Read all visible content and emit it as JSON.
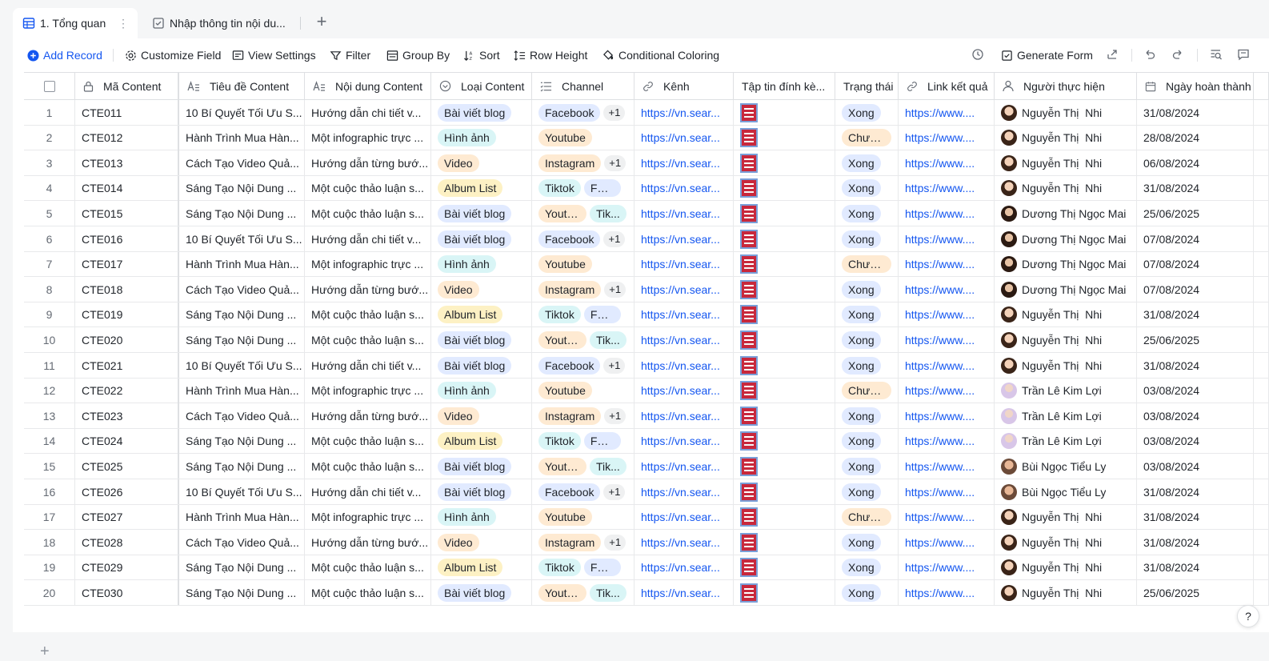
{
  "tabs": [
    {
      "label": "1. Tổng quan",
      "active": true,
      "icon": "table-icon"
    },
    {
      "label": "Nhập thông tin nội du...",
      "active": false,
      "icon": "form-icon"
    }
  ],
  "toolbar": {
    "add_record": "Add Record",
    "customize_field": "Customize Field",
    "view_settings": "View Settings",
    "filter": "Filter",
    "group_by": "Group By",
    "sort": "Sort",
    "row_height": "Row Height",
    "conditional_coloring": "Conditional Coloring",
    "generate_form": "Generate Form"
  },
  "columns": [
    {
      "label": "Mã Content",
      "icon": "lock-icon"
    },
    {
      "label": "Tiêu đề Content",
      "icon": "text-icon"
    },
    {
      "label": "Nội dung Content",
      "icon": "text-icon"
    },
    {
      "label": "Loại Content",
      "icon": "single-select-icon"
    },
    {
      "label": "Channel",
      "icon": "multi-select-icon"
    },
    {
      "label": "Kênh",
      "icon": "link-icon"
    },
    {
      "label": "Tập tin đính kè...",
      "icon": "attachment-icon"
    },
    {
      "label": "Trạng thái",
      "icon": "status-icon"
    },
    {
      "label": "Link kết quả",
      "icon": "link-icon"
    },
    {
      "label": "Người thực hiện",
      "icon": "person-icon"
    },
    {
      "label": "Ngày hoàn thành",
      "icon": "calendar-icon"
    }
  ],
  "colors": {
    "accent": "#1456f0",
    "tag_blog": "#e1eaff",
    "tag_image": "#d9f5f6",
    "tag_video": "#feead2",
    "tag_album": "#fdf1c4",
    "tag_facebook": "#e1eaff",
    "tag_youtube": "#feead2",
    "tag_instagram": "#feead2",
    "tag_tiktok": "#d9f5f6",
    "status_done": "#e1eaff",
    "status_pending": "#feead2"
  },
  "rows": [
    {
      "n": "1",
      "code": "CTE011",
      "title": "10 Bí Quyết Tối Ưu S...",
      "content": "Hướng dẫn chi tiết v...",
      "type": "Bài viết blog",
      "channels": [
        "Facebook"
      ],
      "more": "+1",
      "kenh": "https://vn.sear...",
      "status": "Xong",
      "result": "https://www....",
      "person": "Nguyễn Thị  Nhi",
      "avatar": "a1",
      "date": "31/08/2024"
    },
    {
      "n": "2",
      "code": "CTE012",
      "title": "Hành Trình Mua Hàn...",
      "content": "Một infographic trực ...",
      "type": "Hình ảnh",
      "channels": [
        "Youtube"
      ],
      "more": "",
      "kenh": "https://vn.sear...",
      "status": "Chưa...",
      "result": "https://www....",
      "person": "Nguyễn Thị  Nhi",
      "avatar": "a1",
      "date": "28/08/2024"
    },
    {
      "n": "3",
      "code": "CTE013",
      "title": "Cách Tạo Video Quả...",
      "content": "Hướng dẫn từng bướ...",
      "type": "Video",
      "channels": [
        "Instagram"
      ],
      "more": "+1",
      "kenh": "https://vn.sear...",
      "status": "Xong",
      "result": "https://www....",
      "person": "Nguyễn Thị  Nhi",
      "avatar": "a1",
      "date": "06/08/2024"
    },
    {
      "n": "4",
      "code": "CTE014",
      "title": "Sáng Tạo Nội Dung ...",
      "content": "Một cuộc thảo luận s...",
      "type": "Album List",
      "channels": [
        "Tiktok",
        "Face..."
      ],
      "more": "",
      "kenh": "https://vn.sear...",
      "status": "Xong",
      "result": "https://www....",
      "person": "Nguyễn Thị  Nhi",
      "avatar": "a1",
      "date": "31/08/2024"
    },
    {
      "n": "5",
      "code": "CTE015",
      "title": "Sáng Tạo Nội Dung ...",
      "content": "Một cuộc thảo luận s...",
      "type": "Bài viết blog",
      "channels": [
        "Youtube",
        "Tik..."
      ],
      "more": "",
      "kenh": "https://vn.sear...",
      "status": "Xong",
      "result": "https://www....",
      "person": "Dương Thị Ngọc Mai",
      "avatar": "a2",
      "date": "25/06/2025"
    },
    {
      "n": "6",
      "code": "CTE016",
      "title": "10 Bí Quyết Tối Ưu S...",
      "content": "Hướng dẫn chi tiết v...",
      "type": "Bài viết blog",
      "channels": [
        "Facebook"
      ],
      "more": "+1",
      "kenh": "https://vn.sear...",
      "status": "Xong",
      "result": "https://www....",
      "person": "Dương Thị Ngọc Mai",
      "avatar": "a2",
      "date": "07/08/2024"
    },
    {
      "n": "7",
      "code": "CTE017",
      "title": "Hành Trình Mua Hàn...",
      "content": "Một infographic trực ...",
      "type": "Hình ảnh",
      "channels": [
        "Youtube"
      ],
      "more": "",
      "kenh": "https://vn.sear...",
      "status": "Chưa...",
      "result": "https://www....",
      "person": "Dương Thị Ngọc Mai",
      "avatar": "a2",
      "date": "07/08/2024"
    },
    {
      "n": "8",
      "code": "CTE018",
      "title": "Cách Tạo Video Quả...",
      "content": "Hướng dẫn từng bướ...",
      "type": "Video",
      "channels": [
        "Instagram"
      ],
      "more": "+1",
      "kenh": "https://vn.sear...",
      "status": "Xong",
      "result": "https://www....",
      "person": "Dương Thị Ngọc Mai",
      "avatar": "a2",
      "date": "07/08/2024"
    },
    {
      "n": "9",
      "code": "CTE019",
      "title": "Sáng Tạo Nội Dung ...",
      "content": "Một cuộc thảo luận s...",
      "type": "Album List",
      "channels": [
        "Tiktok",
        "Face..."
      ],
      "more": "",
      "kenh": "https://vn.sear...",
      "status": "Xong",
      "result": "https://www....",
      "person": "Nguyễn Thị  Nhi",
      "avatar": "a1",
      "date": "31/08/2024"
    },
    {
      "n": "10",
      "code": "CTE020",
      "title": "Sáng Tạo Nội Dung ...",
      "content": "Một cuộc thảo luận s...",
      "type": "Bài viết blog",
      "channels": [
        "Youtube",
        "Tik..."
      ],
      "more": "",
      "kenh": "https://vn.sear...",
      "status": "Xong",
      "result": "https://www....",
      "person": "Nguyễn Thị  Nhi",
      "avatar": "a1",
      "date": "25/06/2025"
    },
    {
      "n": "11",
      "code": "CTE021",
      "title": "10 Bí Quyết Tối Ưu S...",
      "content": "Hướng dẫn chi tiết v...",
      "type": "Bài viết blog",
      "channels": [
        "Facebook"
      ],
      "more": "+1",
      "kenh": "https://vn.sear...",
      "status": "Xong",
      "result": "https://www....",
      "person": "Nguyễn Thị  Nhi",
      "avatar": "a1",
      "date": "31/08/2024"
    },
    {
      "n": "12",
      "code": "CTE022",
      "title": "Hành Trình Mua Hàn...",
      "content": "Một infographic trực ...",
      "type": "Hình ảnh",
      "channels": [
        "Youtube"
      ],
      "more": "",
      "kenh": "https://vn.sear...",
      "status": "Chưa...",
      "result": "https://www....",
      "person": "Trần Lê Kim Lợi",
      "avatar": "a3",
      "date": "03/08/2024"
    },
    {
      "n": "13",
      "code": "CTE023",
      "title": "Cách Tạo Video Quả...",
      "content": "Hướng dẫn từng bướ...",
      "type": "Video",
      "channels": [
        "Instagram"
      ],
      "more": "+1",
      "kenh": "https://vn.sear...",
      "status": "Xong",
      "result": "https://www....",
      "person": "Trần Lê Kim Lợi",
      "avatar": "a3",
      "date": "03/08/2024"
    },
    {
      "n": "14",
      "code": "CTE024",
      "title": "Sáng Tạo Nội Dung ...",
      "content": "Một cuộc thảo luận s...",
      "type": "Album List",
      "channels": [
        "Tiktok",
        "Face..."
      ],
      "more": "",
      "kenh": "https://vn.sear...",
      "status": "Xong",
      "result": "https://www....",
      "person": "Trần Lê Kim Lợi",
      "avatar": "a3",
      "date": "03/08/2024"
    },
    {
      "n": "15",
      "code": "CTE025",
      "title": "Sáng Tạo Nội Dung ...",
      "content": "Một cuộc thảo luận s...",
      "type": "Bài viết blog",
      "channels": [
        "Youtube",
        "Tik..."
      ],
      "more": "",
      "kenh": "https://vn.sear...",
      "status": "Xong",
      "result": "https://www....",
      "person": "Bùi Ngọc Tiểu Ly",
      "avatar": "a4",
      "date": "03/08/2024"
    },
    {
      "n": "16",
      "code": "CTE026",
      "title": "10 Bí Quyết Tối Ưu S...",
      "content": "Hướng dẫn chi tiết v...",
      "type": "Bài viết blog",
      "channels": [
        "Facebook"
      ],
      "more": "+1",
      "kenh": "https://vn.sear...",
      "status": "Xong",
      "result": "https://www....",
      "person": "Bùi Ngọc Tiểu Ly",
      "avatar": "a4",
      "date": "31/08/2024"
    },
    {
      "n": "17",
      "code": "CTE027",
      "title": "Hành Trình Mua Hàn...",
      "content": "Một infographic trực ...",
      "type": "Hình ảnh",
      "channels": [
        "Youtube"
      ],
      "more": "",
      "kenh": "https://vn.sear...",
      "status": "Chưa...",
      "result": "https://www....",
      "person": "Nguyễn Thị  Nhi",
      "avatar": "a1",
      "date": "31/08/2024"
    },
    {
      "n": "18",
      "code": "CTE028",
      "title": "Cách Tạo Video Quả...",
      "content": "Hướng dẫn từng bướ...",
      "type": "Video",
      "channels": [
        "Instagram"
      ],
      "more": "+1",
      "kenh": "https://vn.sear...",
      "status": "Xong",
      "result": "https://www....",
      "person": "Nguyễn Thị  Nhi",
      "avatar": "a1",
      "date": "31/08/2024"
    },
    {
      "n": "19",
      "code": "CTE029",
      "title": "Sáng Tạo Nội Dung ...",
      "content": "Một cuộc thảo luận s...",
      "type": "Album List",
      "channels": [
        "Tiktok",
        "Face..."
      ],
      "more": "",
      "kenh": "https://vn.sear...",
      "status": "Xong",
      "result": "https://www....",
      "person": "Nguyễn Thị  Nhi",
      "avatar": "a1",
      "date": "31/08/2024"
    },
    {
      "n": "20",
      "code": "CTE030",
      "title": "Sáng Tạo Nội Dung ...",
      "content": "Một cuộc thảo luận s...",
      "type": "Bài viết blog",
      "channels": [
        "Youtube",
        "Tik..."
      ],
      "more": "",
      "kenh": "https://vn.sear...",
      "status": "Xong",
      "result": "https://www....",
      "person": "Nguyễn Thị  Nhi",
      "avatar": "a1",
      "date": "25/06/2025"
    }
  ],
  "add_row_symbol": "+",
  "help_symbol": "?"
}
